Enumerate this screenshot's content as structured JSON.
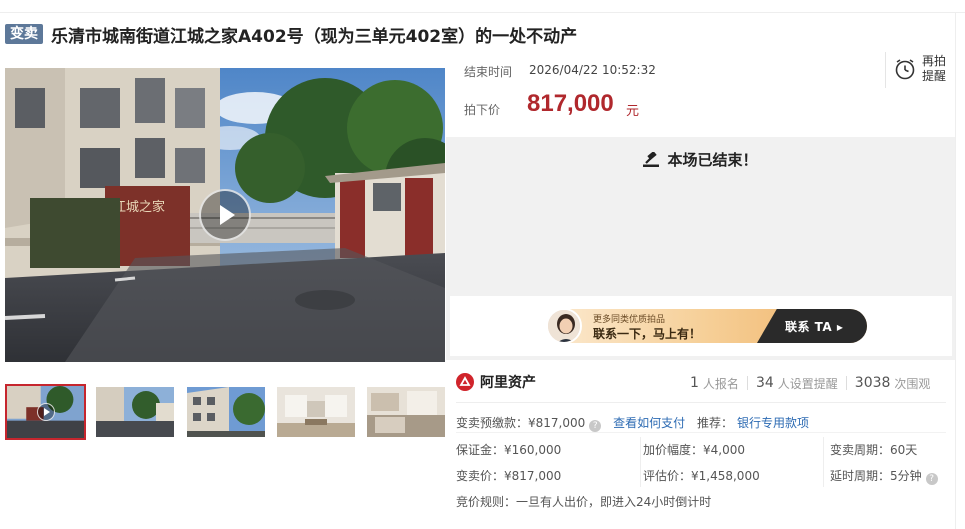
{
  "header": {
    "badge": "变卖",
    "title": "乐清市城南街道江城之家A402号（现为三单元402室）的一处不动产"
  },
  "gallery": {
    "main_image_sign": "江城之家",
    "thumbnails": [
      "video-entrance",
      "street-view",
      "building-exterior",
      "living-room",
      "kitchen"
    ],
    "active_index": 0
  },
  "auction": {
    "end_time_label": "结束时间",
    "end_time": "2026/04/22 10:52:32",
    "price_label": "拍下价",
    "price": "817,000",
    "price_unit": "元",
    "remind_label": "再拍提醒",
    "ended_text": "本场已结束！"
  },
  "contact": {
    "subtitle": "更多同类优质拍品",
    "main": "联系一下，马上有！",
    "button": "联系 TA ▸"
  },
  "platform": {
    "name": "阿里资产"
  },
  "stats": {
    "signups_num": "1",
    "signups_label": "人报名",
    "reminders_num": "34",
    "reminders_label": "人设置提醒",
    "views_num": "3038",
    "views_label": "次围观"
  },
  "details": {
    "deposit_label": "变卖预缴款：",
    "deposit_value": "¥817,000",
    "how_to_pay": "查看如何支付",
    "recommend_label": "推荐：",
    "recommend_link": "银行专用款项",
    "margin": "保证金：¥160,000",
    "increment": "加价幅度：¥4,000",
    "period": "变卖周期：60天",
    "sale_price": "变卖价：¥817,000",
    "appraisal": "评估价：¥1,458,000",
    "delay": "延时周期：5分钟",
    "rule_label": "竞价规则：",
    "rule_text": "一旦有人出价，即进入24小时倒计时"
  },
  "colors": {
    "badge_bg": "#5d7899",
    "price_red": "#b0282d",
    "link_blue": "#2d6bb3",
    "ended_bg": "#f1f1f1"
  }
}
